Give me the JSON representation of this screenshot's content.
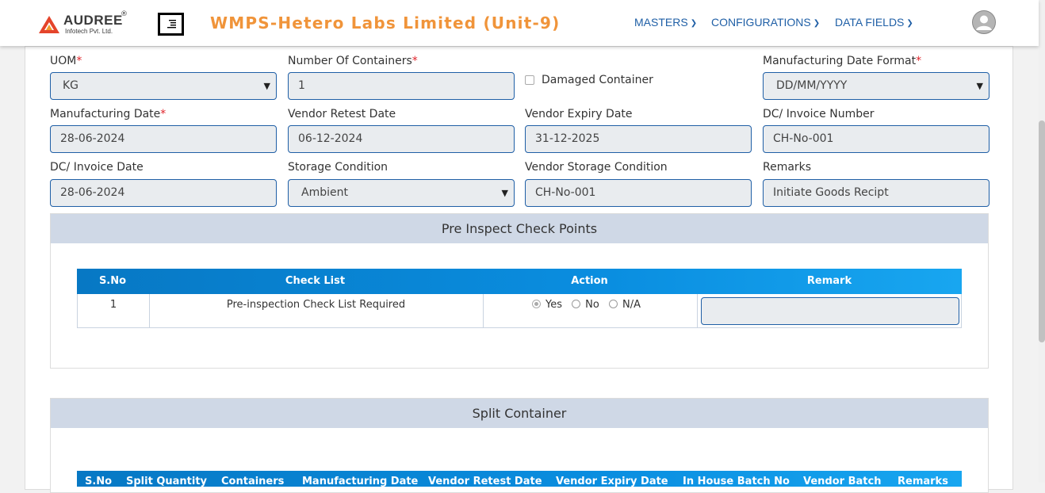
{
  "header": {
    "logo_name": "AUDREE",
    "logo_reg": "®",
    "logo_sub": "Infotech Pvt. Ltd.",
    "title": "WMPS-Hetero Labs Limited (Unit-9)",
    "nav": [
      {
        "label": "MASTERS"
      },
      {
        "label": "CONFIGURATIONS"
      },
      {
        "label": "DATA FIELDS"
      }
    ],
    "brand_color": "#f0943a",
    "nav_color": "#1f5fa6",
    "icons": {
      "logo": "audree-logo-icon",
      "menu": "menu-toggle-icon",
      "avatar": "user-avatar-icon",
      "chevron": "chevron-down-icon"
    }
  },
  "form": {
    "uom": {
      "label": "UOM",
      "required": "*",
      "value": "KG"
    },
    "num_containers": {
      "label": "Number Of Containers",
      "required": "*",
      "value": "1"
    },
    "damaged": {
      "label": "Damaged Container",
      "checked": false
    },
    "mfg_date_format": {
      "label": "Manufacturing Date Format",
      "required": "*",
      "value": "DD/MM/YYYY"
    },
    "mfg_date": {
      "label": "Manufacturing Date",
      "required": "*",
      "value": "28-06-2024"
    },
    "vendor_retest": {
      "label": "Vendor Retest Date",
      "value": "06-12-2024"
    },
    "vendor_expiry": {
      "label": "Vendor Expiry Date",
      "value": "31-12-2025"
    },
    "dc_invoice_number": {
      "label": "DC/ Invoice Number",
      "value": "CH-No-001"
    },
    "dc_invoice_date": {
      "label": "DC/ Invoice Date",
      "value": "28-06-2024"
    },
    "storage_condition": {
      "label": "Storage Condition",
      "value": "Ambient"
    },
    "vendor_storage": {
      "label": "Vendor Storage Condition",
      "value": "CH-No-001"
    },
    "remarks": {
      "label": "Remarks",
      "value": "Initiate Goods Recipt"
    }
  },
  "pre_inspect": {
    "title": "Pre Inspect Check Points",
    "columns": [
      "S.No",
      "Check List",
      "Action",
      "Remark"
    ],
    "rows": [
      {
        "sno": "1",
        "check": "Pre-inspection Check List Required",
        "options": [
          "Yes",
          "No",
          "N/A"
        ],
        "selected": "Yes",
        "remark": ""
      }
    ]
  },
  "split_container": {
    "title": "Split Container",
    "columns": [
      "S.No",
      "Split Quantity",
      "Containers",
      "Manufacturing Date",
      "Vendor Retest Date",
      "Vendor Expiry Date",
      "In House Batch No",
      "Vendor Batch",
      "Remarks"
    ]
  }
}
